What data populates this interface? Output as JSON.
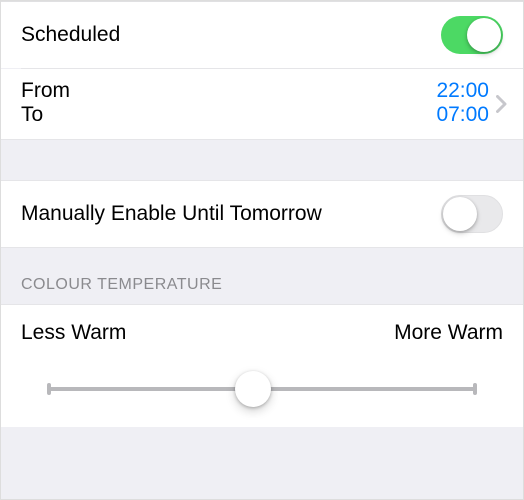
{
  "scheduled": {
    "label": "Scheduled",
    "on": true
  },
  "schedule": {
    "from_label": "From",
    "to_label": "To",
    "from_value": "22:00",
    "to_value": "07:00"
  },
  "manual": {
    "label": "Manually Enable Until Tomorrow",
    "on": false
  },
  "section": {
    "colour_temperature": "COLOUR TEMPERATURE"
  },
  "slider": {
    "less_label": "Less Warm",
    "more_label": "More Warm"
  }
}
